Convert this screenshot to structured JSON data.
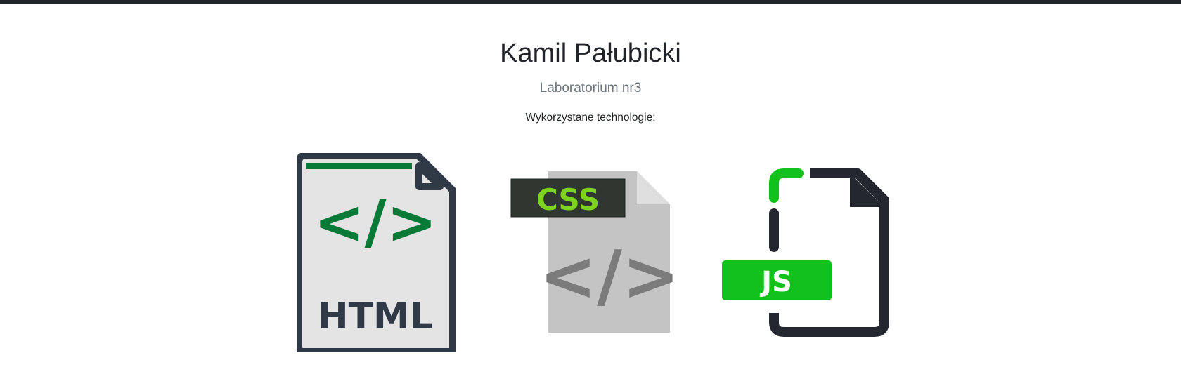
{
  "header": {
    "name": "Kamil Pałubicki",
    "subtitle": "Laboratorium nr3",
    "technologies_label": "Wykorzystane technologie:"
  },
  "technologies": [
    {
      "icon": "html-file-icon",
      "code_glyph": "</>",
      "label": "HTML",
      "accent": "#077a37",
      "frame": "#2f3a46",
      "fill": "#e4e4e4"
    },
    {
      "icon": "css-file-icon",
      "code_glyph": "</>",
      "label": "CSS",
      "accent": "#7ed321",
      "frame": "#c5c4c5",
      "fill": "#c5c4c5",
      "tag_bg": "#303630"
    },
    {
      "icon": "js-file-icon",
      "label": "JS",
      "accent": "#12c11b",
      "frame": "#24272f"
    }
  ]
}
